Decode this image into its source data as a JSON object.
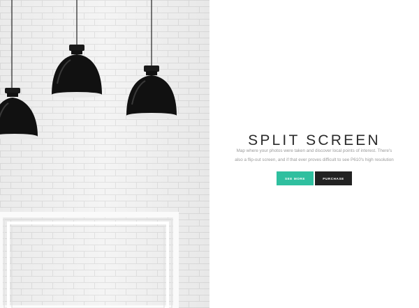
{
  "hero": {
    "image": "brick-wall-with-pendant-lamps",
    "title": "SPLIT SCREEN",
    "description": [
      "Map where your photos were taken and discover local points of interest. There's",
      "also a flip-out screen, and if that ever proves difficult to see P610's high resolution"
    ],
    "buttons": {
      "see_more": "SEE MORE",
      "purchase": "PURCHASE"
    }
  },
  "colors": {
    "accent": "#2fbf9f",
    "dark": "#222222",
    "wall": "#f3f3f3"
  }
}
